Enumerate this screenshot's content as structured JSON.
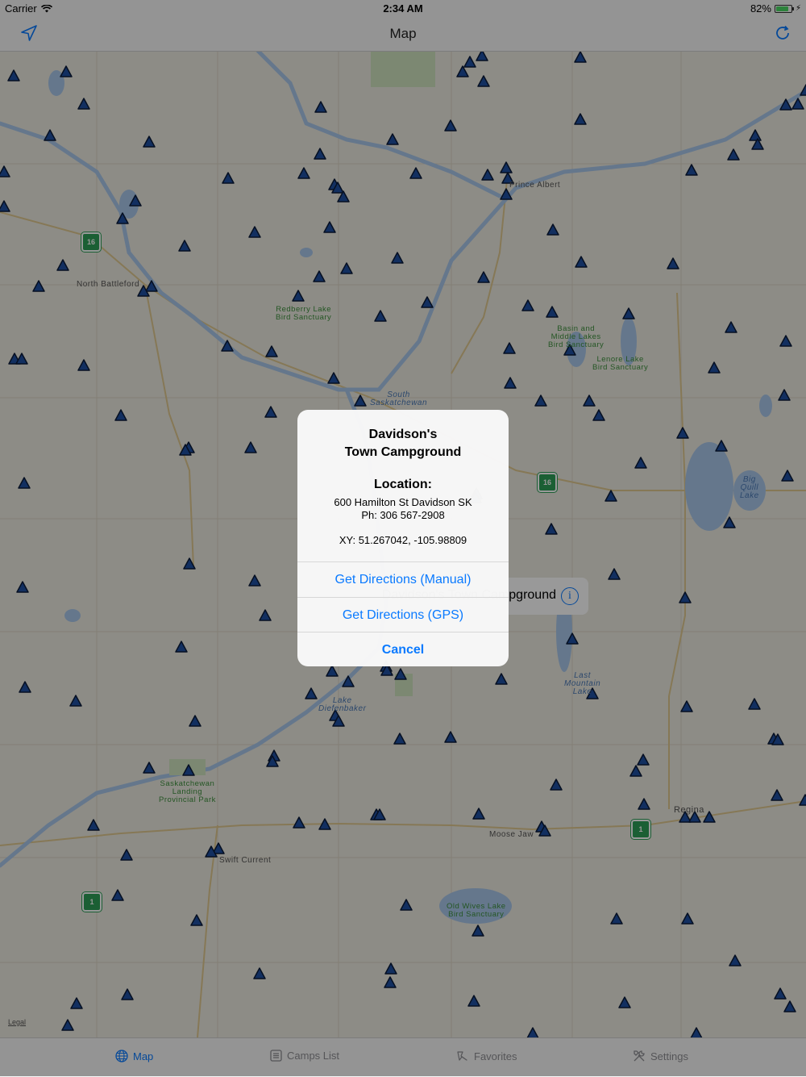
{
  "status_bar": {
    "carrier": "Carrier",
    "time": "2:34 AM",
    "battery": "82%",
    "battery_level": 0.82
  },
  "nav": {
    "title": "Map",
    "left_icon": "location-arrow-icon",
    "right_icon": "refresh-icon"
  },
  "map": {
    "labels": {
      "prince_albert": "Prince Albert",
      "north_battleford": "North Battleford",
      "swift_current": "Swift Current",
      "moose_jaw": "Moose Jaw",
      "regina": "Regina",
      "redberry": "Redberry Lake\nBird Sanctuary",
      "basin": "Basin and\nMiddle Lakes\nBird Sanctuary",
      "lenore": "Lenore Lake\nBird Sanctuary",
      "south_sask": "South\nSaskatchewan",
      "big_quill": "Big\nQuill\nLake",
      "last_mountain": "Last\nMountain\nLake",
      "lake_diefenbaker": "Lake\nDiefenbaker",
      "sask_landing": "Saskatchewan\nLanding\nProvincial Park",
      "old_wives": "Old Wives Lake\nBird Sanctuary"
    },
    "highways": {
      "h16a": "16",
      "h16b": "16",
      "h1a": "1",
      "h1b": "1"
    },
    "legal": "Legal",
    "callout_text": "Davidson's Town Campground"
  },
  "alert": {
    "title_line1": "Davidson's",
    "title_line2": "Town Campground",
    "location_heading": "Location:",
    "address": "600 Hamilton St Davidson SK",
    "phone": "Ph: 306 567-2908",
    "coords": "XY: 51.267042, -105.98809",
    "btn_manual": "Get Directions (Manual)",
    "btn_gps": "Get Directions (GPS)",
    "btn_cancel": "Cancel"
  },
  "tabs": [
    {
      "label": "Map",
      "icon": "globe-icon",
      "active": true
    },
    {
      "label": "Camps List",
      "icon": "list-icon",
      "active": false
    },
    {
      "label": "Favorites",
      "icon": "favorites-icon",
      "active": false
    },
    {
      "label": "Settings",
      "icon": "tools-icon",
      "active": false
    }
  ],
  "colors": {
    "accent": "#0a7aff",
    "marker": "#1f4fa0",
    "water": "#a9c7ea",
    "park": "#cfe3bf"
  }
}
